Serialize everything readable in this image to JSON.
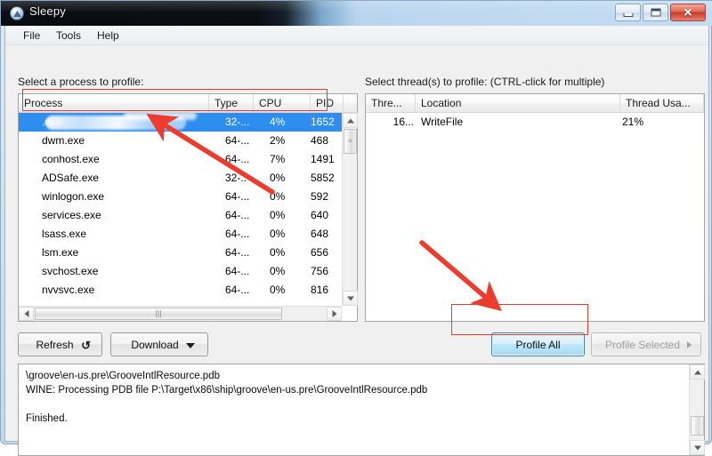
{
  "window": {
    "title": "Sleepy",
    "app_icon": "sleepy-app-icon",
    "controls": {
      "minimize": "minimize-button",
      "maximize": "maximize-button",
      "close": "close-button",
      "close_glyph": "✕"
    }
  },
  "menubar": {
    "items": [
      {
        "label": "File"
      },
      {
        "label": "Tools"
      },
      {
        "label": "Help"
      }
    ]
  },
  "process_panel": {
    "label": "Select a process to profile:",
    "columns": [
      "Process",
      "Type",
      "CPU",
      "PID"
    ],
    "sorted_column": "CPU",
    "sort_direction": "descending",
    "rows": [
      {
        "process": ".exe",
        "type": "32-...",
        "cpu": "4%",
        "pid": "1652",
        "selected": true,
        "redacted": true
      },
      {
        "process": "dwm.exe",
        "type": "64-...",
        "cpu": "2%",
        "pid": "468",
        "selected": false,
        "redacted": false
      },
      {
        "process": "conhost.exe",
        "type": "64-...",
        "cpu": "7%",
        "pid": "1491",
        "selected": false,
        "redacted": false
      },
      {
        "process": "ADSafe.exe",
        "type": "32-..",
        "cpu": "0%",
        "pid": "5852",
        "selected": false,
        "redacted": false
      },
      {
        "process": "winlogon.exe",
        "type": "64-...",
        "cpu": "0%",
        "pid": "592",
        "selected": false,
        "redacted": false
      },
      {
        "process": "services.exe",
        "type": "64-...",
        "cpu": "0%",
        "pid": "640",
        "selected": false,
        "redacted": false
      },
      {
        "process": "lsass.exe",
        "type": "64-...",
        "cpu": "0%",
        "pid": "648",
        "selected": false,
        "redacted": false
      },
      {
        "process": "lsm.exe",
        "type": "64-...",
        "cpu": "0%",
        "pid": "656",
        "selected": false,
        "redacted": false
      },
      {
        "process": "svchost.exe",
        "type": "64-...",
        "cpu": "0%",
        "pid": "756",
        "selected": false,
        "redacted": false
      },
      {
        "process": "nvvsvc.exe",
        "type": "64-...",
        "cpu": "0%",
        "pid": "816",
        "selected": false,
        "redacted": false
      }
    ]
  },
  "thread_panel": {
    "label": "Select thread(s) to profile: (CTRL-click for multiple)",
    "columns": [
      "Thre...",
      "Location",
      "Thread Usa..."
    ],
    "sorted_column": "Thread Usa...",
    "sort_direction": "descending",
    "rows": [
      {
        "thread": "16...",
        "location": "WriteFile",
        "usage": "21%"
      }
    ]
  },
  "buttons": {
    "refresh": {
      "label": "Refresh",
      "icon": "refresh-sync-icon",
      "enabled": true
    },
    "download": {
      "label": "Download",
      "icon": "chevron-down-icon",
      "enabled": true
    },
    "profile_all": {
      "label": "Profile All",
      "enabled": true,
      "focused": true
    },
    "profile_selected": {
      "label": "Profile Selected",
      "icon": "chevron-right-icon",
      "enabled": false
    }
  },
  "log": {
    "lines": [
      "\\groove\\en-us.pre\\GrooveIntlResource.pdb",
      "WINE: Processing PDB file P:\\Target\\x86\\ship\\groove\\en-us.pre\\GrooveIntlResource.pdb",
      "",
      "Finished."
    ],
    "text": "\\groove\\en-us.pre\\GrooveIntlResource.pdb\nWINE: Processing PDB file P:\\Target\\x86\\ship\\groove\\en-us.pre\\GrooveIntlResource.pdb\n\nFinished."
  },
  "annotations": {
    "accent_color": "#e23b32",
    "highlight_boxes": [
      "selected-process-row",
      "profile-all-button"
    ],
    "arrows": [
      "arrow-to-selected-process-row",
      "arrow-to-profile-all-button"
    ]
  },
  "colors": {
    "selection_blue": "#2d8ef0",
    "focus_button_blue": "#bee6fd",
    "annotation_red": "#e23b32",
    "titlebar_glass": "#c3dcf2"
  }
}
